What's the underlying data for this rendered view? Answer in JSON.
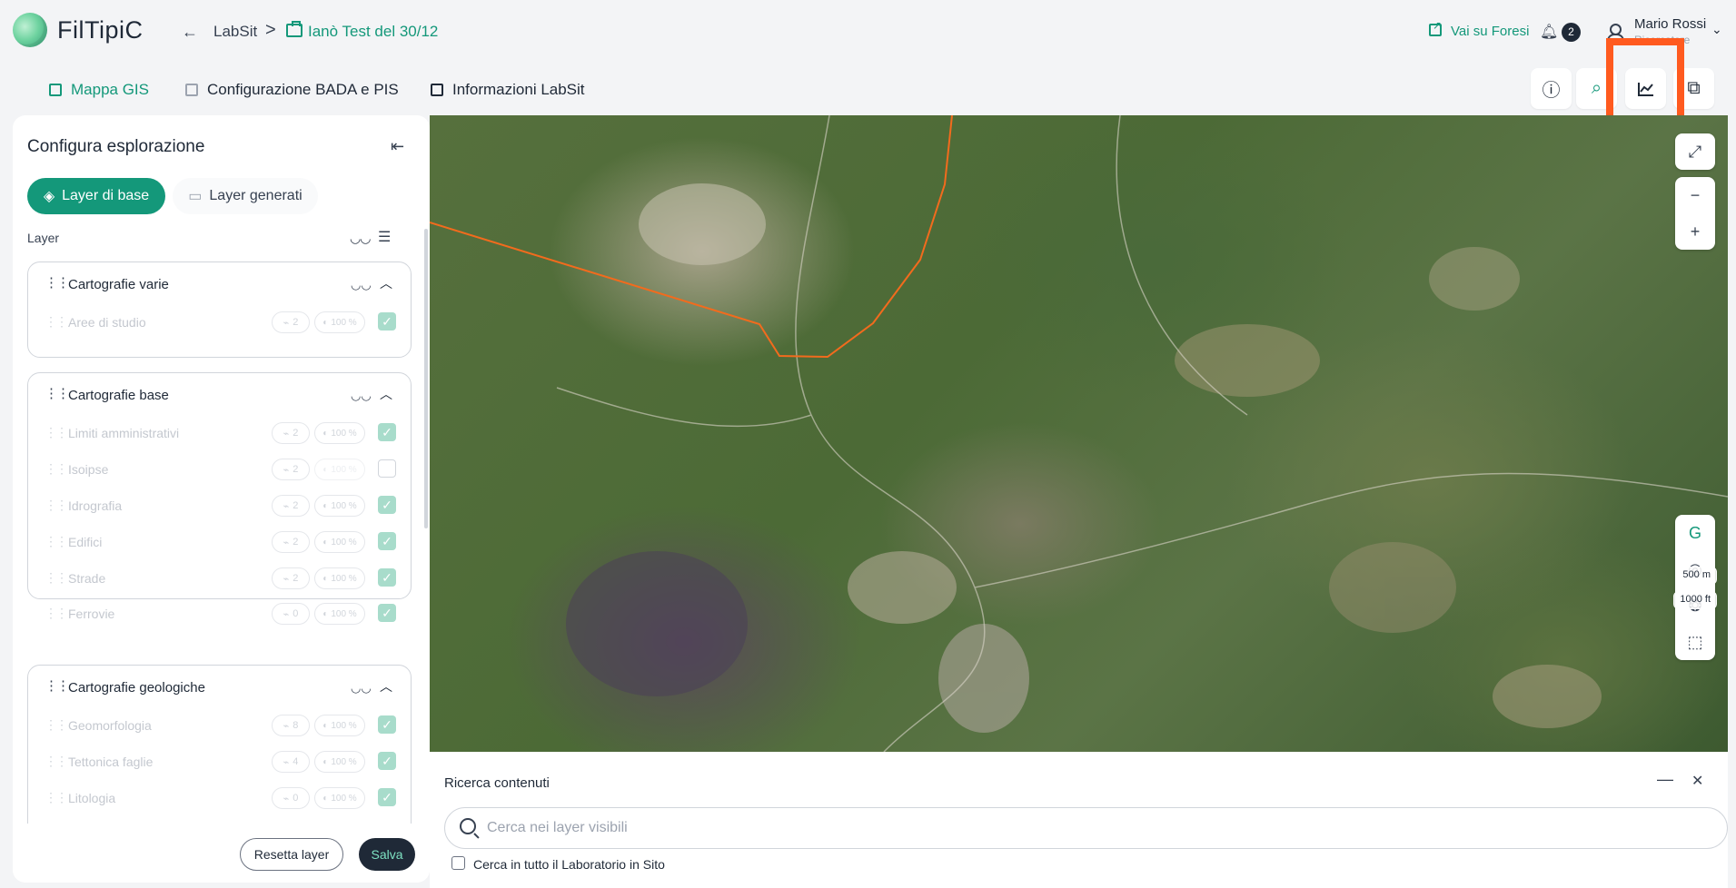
{
  "header": {
    "brand": "FilTipiC",
    "back_arrow": "←",
    "breadcrumb_1": "LabSit",
    "breadcrumb_sep": ">",
    "breadcrumb_2": "Ianò Test del 30/12",
    "external_link": "Vai su Foresi",
    "notifications_count": "2",
    "user_name": "Mario Rossi",
    "user_role": "Ricercatore"
  },
  "tabs": [
    {
      "label": "Mappa GIS",
      "active": true
    },
    {
      "label": "Configurazione BADA e PIS",
      "active": false
    },
    {
      "label": "Informazioni LabSit",
      "active": false
    }
  ],
  "toolbar_icons": [
    "info-cursor-icon",
    "search-icon",
    "chart-line-icon",
    "layers-box-icon"
  ],
  "panel": {
    "title": "Configura esplorazione",
    "pill_base": "Layer di base",
    "pill_generated": "Layer generati",
    "layer_label": "Layer",
    "reset_label": "Resetta layer",
    "save_label": "Salva"
  },
  "groups": [
    {
      "title": "Cartografie varie",
      "rows": [
        {
          "name": "Aree di studio",
          "count": "2",
          "opacity": "100 %",
          "checked": true
        }
      ]
    },
    {
      "title": "Cartografie base",
      "rows": [
        {
          "name": "Limiti amministrativi",
          "count": "2",
          "opacity": "100 %",
          "checked": true
        },
        {
          "name": "Isoipse",
          "count": "2",
          "opacity": "100 %",
          "checked": false
        },
        {
          "name": "Idrografia",
          "count": "2",
          "opacity": "100 %",
          "checked": true
        },
        {
          "name": "Edifici",
          "count": "2",
          "opacity": "100 %",
          "checked": true
        },
        {
          "name": "Strade",
          "count": "2",
          "opacity": "100 %",
          "checked": true
        },
        {
          "name": "Ferrovie",
          "count": "0",
          "opacity": "100 %",
          "checked": true
        }
      ]
    },
    {
      "title": "Cartografie geologiche",
      "rows": [
        {
          "name": "Geomorfologia",
          "count": "8",
          "opacity": "100 %",
          "checked": true
        },
        {
          "name": "Tettonica faglie",
          "count": "4",
          "opacity": "100 %",
          "checked": true
        },
        {
          "name": "Litologia",
          "count": "0",
          "opacity": "100 %",
          "checked": true
        }
      ]
    }
  ],
  "map": {
    "scale_metric": "500 m",
    "scale_imperial": "1000 ft",
    "route_color": "#f26b1d"
  },
  "search": {
    "title": "Ricerca contenuti",
    "placeholder": "Cerca nei layer visibili",
    "checkbox_label": "Cerca in tutto il Laboratorio in Sito"
  },
  "colors": {
    "accent": "#14987a",
    "highlight": "#ff5a1f",
    "dark": "#1f2937"
  }
}
